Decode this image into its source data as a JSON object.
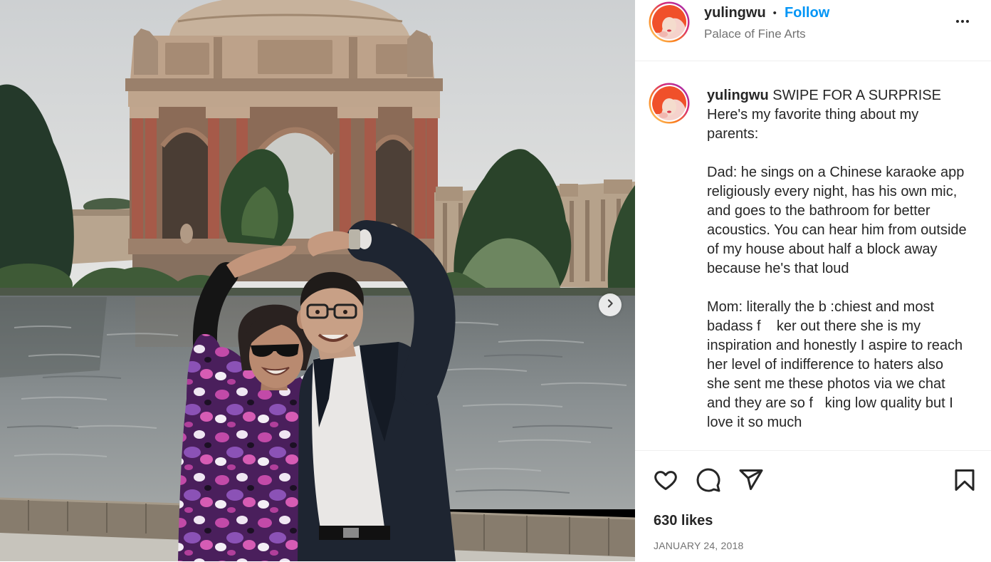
{
  "header": {
    "username": "yulingwu",
    "separator": "•",
    "follow_label": "Follow",
    "location": "Palace of Fine Arts"
  },
  "caption": {
    "username": "yulingwu",
    "lines": [
      "SWIPE FOR A SURPRISE",
      "Here's my favorite thing about my",
      "parents:",
      "",
      "Dad: he sings on a Chinese karaoke app",
      "religiously every night, has his own mic,",
      "and goes to the bathroom for better",
      "acoustics. You can hear him from outside",
      "of my house about half a block away",
      "because he's that loud",
      "",
      "Mom: literally the b :chiest and most",
      "badass f    ker out there she is my",
      "inspiration and honestly I aspire to reach",
      "her level of indifference to haters also",
      "she sent me these photos via we chat",
      "and they are so f   king low quality but I",
      "love it so much"
    ]
  },
  "likes": "630 likes",
  "date": "JANUARY 24, 2018",
  "icons": {
    "more": "more-horizontal-icon",
    "next": "chevron-right-icon",
    "like": "heart-icon",
    "comment": "comment-icon",
    "share": "paper-plane-icon",
    "save": "bookmark-icon"
  },
  "colors": {
    "accent": "#0095f6",
    "text": "#262626",
    "secondary_text": "#737373",
    "divider": "#efefef"
  }
}
